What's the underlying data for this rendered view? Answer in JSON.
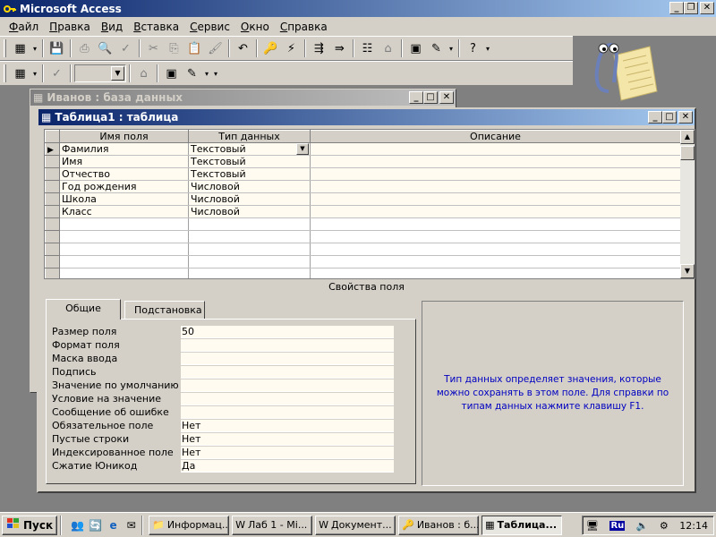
{
  "app": {
    "title": "Microsoft Access"
  },
  "menu": {
    "items": [
      {
        "label": "Файл",
        "ul": "Ф",
        "rest": "айл"
      },
      {
        "label": "Правка",
        "ul": "П",
        "rest": "равка"
      },
      {
        "label": "Вид",
        "ul": "В",
        "rest": "ид"
      },
      {
        "label": "Вставка",
        "ul": "В",
        "rest": "ставка"
      },
      {
        "label": "Сервис",
        "ul": "С",
        "rest": "ервис"
      },
      {
        "label": "Окно",
        "ul": "О",
        "rest": "кно"
      },
      {
        "label": "Справка",
        "ul": "С",
        "rest": "правка"
      }
    ]
  },
  "db_window": {
    "title": "Иванов : база данных"
  },
  "table_window": {
    "title": "Таблица1 : таблица",
    "columns": [
      "Имя поля",
      "Тип данных",
      "Описание"
    ],
    "rows": [
      {
        "name": "Фамилия",
        "type": "Текстовый",
        "desc": ""
      },
      {
        "name": "Имя",
        "type": "Текстовый",
        "desc": ""
      },
      {
        "name": "Отчество",
        "type": "Текстовый",
        "desc": ""
      },
      {
        "name": "Год рождения",
        "type": "Числовой",
        "desc": ""
      },
      {
        "name": "Школа",
        "type": "Числовой",
        "desc": ""
      },
      {
        "name": "Класс",
        "type": "Числовой",
        "desc": ""
      }
    ],
    "empty_rows": 5,
    "props_label": "Свойства поля",
    "tabs": [
      "Общие",
      "Подстановка"
    ],
    "properties": [
      {
        "label": "Размер поля",
        "value": "50"
      },
      {
        "label": "Формат поля",
        "value": ""
      },
      {
        "label": "Маска ввода",
        "value": ""
      },
      {
        "label": "Подпись",
        "value": ""
      },
      {
        "label": "Значение по умолчанию",
        "value": ""
      },
      {
        "label": "Условие на значение",
        "value": ""
      },
      {
        "label": "Сообщение об ошибке",
        "value": ""
      },
      {
        "label": "Обязательное поле",
        "value": "Нет"
      },
      {
        "label": "Пустые строки",
        "value": "Нет"
      },
      {
        "label": "Индексированное поле",
        "value": "Нет"
      },
      {
        "label": "Сжатие Юникод",
        "value": "Да"
      }
    ],
    "hint": "Тип данных определяет значения, которые можно сохранять в этом поле.  Для справки по типам данных нажмите клавишу F1."
  },
  "taskbar": {
    "start": "Пуск",
    "tasks": [
      "Информац...",
      "Лаб 1 - Mi...",
      "Документ...",
      "Иванов : б...",
      "Таблица..."
    ],
    "lang": "Ru",
    "clock": "12:14"
  }
}
